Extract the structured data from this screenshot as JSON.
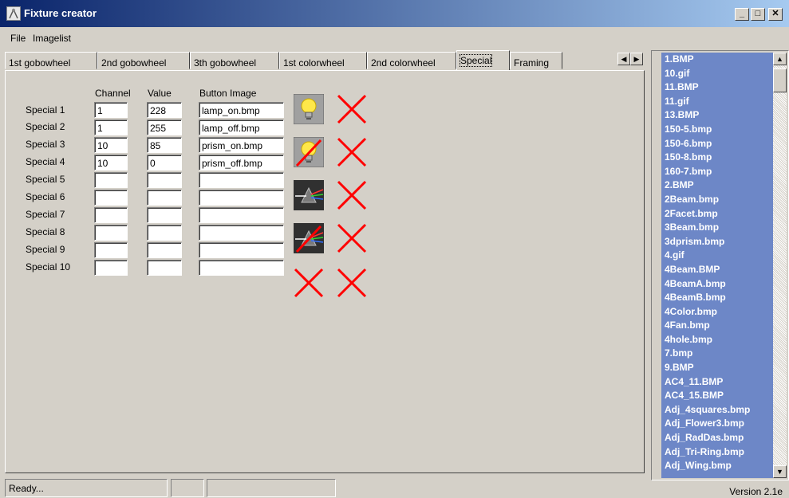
{
  "window": {
    "title": "Fixture creator"
  },
  "menu": [
    "File",
    "Imagelist"
  ],
  "tabs": [
    "1st gobowheel",
    "2nd gobowheel",
    "3th gobowheel",
    "1st colorwheel",
    "2nd colorwheel",
    "Special",
    "Framing"
  ],
  "active_tab": "Special",
  "columns": {
    "channel": "Channel",
    "value": "Value",
    "button_image": "Button Image"
  },
  "rows": [
    {
      "label": "Special 1",
      "channel": "1",
      "value": "228",
      "image": "lamp_on.bmp"
    },
    {
      "label": "Special 2",
      "channel": "1",
      "value": "255",
      "image": "lamp_off.bmp"
    },
    {
      "label": "Special 3",
      "channel": "10",
      "value": "85",
      "image": "prism_on.bmp"
    },
    {
      "label": "Special 4",
      "channel": "10",
      "value": "0",
      "image": "prism_off.bmp"
    },
    {
      "label": "Special 5",
      "channel": "",
      "value": "",
      "image": ""
    },
    {
      "label": "Special 6",
      "channel": "",
      "value": "",
      "image": ""
    },
    {
      "label": "Special 7",
      "channel": "",
      "value": "",
      "image": ""
    },
    {
      "label": "Special 8",
      "channel": "",
      "value": "",
      "image": ""
    },
    {
      "label": "Special 9",
      "channel": "",
      "value": "",
      "image": ""
    },
    {
      "label": "Special 10",
      "channel": "",
      "value": "",
      "image": ""
    }
  ],
  "image_buttons": [
    "lamp-on-icon",
    "lamp-off-icon",
    "prism-on-icon",
    "prism-off-icon",
    "empty-x-icon"
  ],
  "imagelist": [
    "1.BMP",
    "10.gif",
    "11.BMP",
    "11.gif",
    "13.BMP",
    "150-5.bmp",
    "150-6.bmp",
    "150-8.bmp",
    "160-7.bmp",
    "2.BMP",
    "2Beam.bmp",
    "2Facet.bmp",
    "3Beam.bmp",
    "3dprism.bmp",
    "4.gif",
    "4Beam.BMP",
    "4BeamA.bmp",
    "4BeamB.bmp",
    "4Color.bmp",
    "4Fan.bmp",
    "4hole.bmp",
    "7.bmp",
    "9.BMP",
    "AC4_11.BMP",
    "AC4_15.BMP",
    "Adj_4squares.bmp",
    "Adj_Flower3.bmp",
    "Adj_RadDas.bmp",
    "Adj_Tri-Ring.bmp",
    "Adj_Wing.bmp"
  ],
  "status": {
    "text": "Ready...",
    "version": "Version 2.1e"
  },
  "colors": {
    "titlebar_start": "#0a246a",
    "titlebar_end": "#a6caf0",
    "list_bg": "#6d87c7",
    "x_mark": "#ff0000"
  }
}
